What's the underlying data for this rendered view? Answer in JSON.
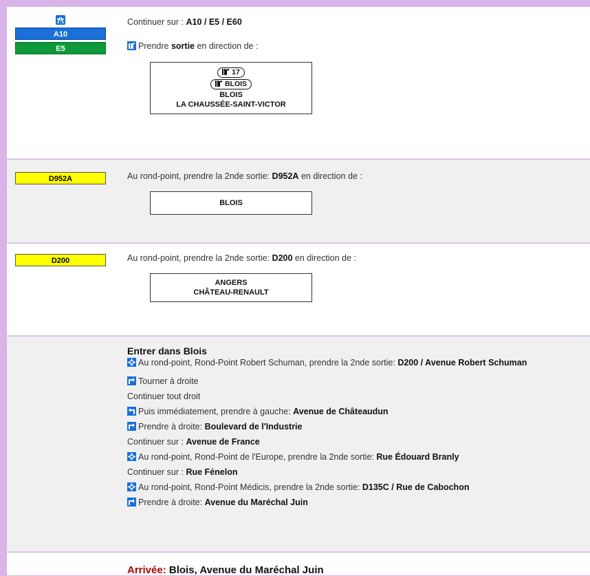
{
  "step1": {
    "badges": [
      "A10",
      "E5"
    ],
    "line1_prefix": "Continuer sur : ",
    "line1_road": "A10 / E5 / E60",
    "line2_a": "Prendre ",
    "line2_b": "sortie",
    "line2_c": " en direction de :",
    "sign_exit": "17",
    "sign_city_box": "BLOIS",
    "sign_line1": "BLOIS",
    "sign_line2": "LA CHAUSSÉE-SAINT-VICTOR"
  },
  "step2": {
    "badge": "D952A",
    "prefix": "Au rond-point, prendre la 2nde sortie: ",
    "road": "D952A",
    "suffix": " en direction de :",
    "sign_line1": "BLOIS"
  },
  "step3": {
    "badge": "D200",
    "prefix": "Au rond-point, prendre la 2nde sortie: ",
    "road": "D200",
    "suffix": " en direction de :",
    "sign_line1": "ANGERS",
    "sign_line2": "CHÂTEAU-RENAULT"
  },
  "step4": {
    "title": "Entrer dans Blois",
    "l1_text": "Au rond-point, Rond-Point Robert Schuman, prendre la 2nde sortie: ",
    "l1_bold": "D200 / Avenue Robert Schuman",
    "l2_text": "Tourner à droite",
    "l3_text": "Continuer tout droit",
    "l4_text": "Puis immédiatement, prendre à gauche: ",
    "l4_bold": "Avenue de Châteaudun",
    "l5_text": "Prendre à droite: ",
    "l5_bold": "Boulevard de l'Industrie",
    "l6_text": "Continuer sur : ",
    "l6_bold": "Avenue de France",
    "l7_text": "Au rond-point, Rond-Point de l'Europe, prendre la 2nde sortie: ",
    "l7_bold": "Rue Édouard Branly",
    "l8_text": "Continuer sur : ",
    "l8_bold": "Rue Fénelon",
    "l9_text": "Au rond-point, Rond-Point Médicis, prendre la 2nde sortie: ",
    "l9_bold": "D135C / Rue de Cabochon",
    "l10_text": "Prendre à droite: ",
    "l10_bold": "Avenue du Maréchal Juin"
  },
  "arrival": {
    "label": "Arrivée:",
    "text": " Blois, Avenue du Maréchal Juin"
  },
  "colors": {
    "background": "#d8b4e8",
    "motorway_blue": "#1a6fd8",
    "european_green": "#0e9a3a",
    "departmental_yellow": "#ffff00",
    "arrival_red": "#b00000",
    "turn_icon_blue": "#1a6fd8"
  },
  "icons": {
    "motorway": "motorway-icon",
    "exit": "exit-icon",
    "roundabout": "roundabout-icon",
    "turn_right": "turn-right-icon",
    "turn_left": "turn-left-icon"
  }
}
